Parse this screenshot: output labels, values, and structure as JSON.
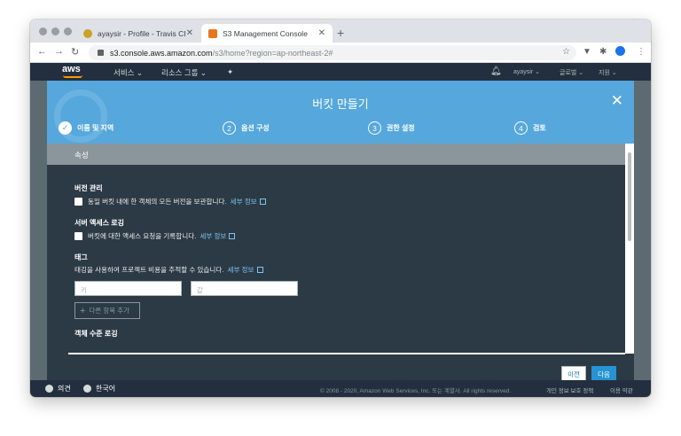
{
  "browser": {
    "tabs": [
      {
        "title": "ayaysir - Profile - Travis CI",
        "favicon_color": "#c9a227"
      },
      {
        "title": "S3 Management Console",
        "favicon_color": "#e8741c"
      }
    ],
    "new_tab": "+",
    "url_host": "s3.console.aws.amazon.com",
    "url_path": "/s3/home?region=ap-northeast-2#"
  },
  "aws_nav": {
    "logo": "aws",
    "services": "서비스 ⌄",
    "resource_groups": "리소스 그룹 ⌄",
    "user": "ayaysir ⌄",
    "region": "글로벌 ⌄",
    "support": "지원 ⌄"
  },
  "modal": {
    "title": "버킷 만들기",
    "close": "✕",
    "steps": [
      {
        "num": "✓",
        "label": "이름 및 지역",
        "done": true
      },
      {
        "num": "2",
        "label": "옵션 구성"
      },
      {
        "num": "3",
        "label": "권한 설정"
      },
      {
        "num": "4",
        "label": "검토"
      }
    ],
    "section_title": "속성",
    "versioning": {
      "label": "버전 관리",
      "checkbox_text": "동일 버킷 내에 한 객체의 모든 버전을 보관합니다.",
      "link": "세부 정보"
    },
    "access_logging": {
      "label": "서버 액세스 로깅",
      "checkbox_text": "버킷에 대한 액세스 요청을 기록합니다.",
      "link": "세부 정보"
    },
    "tags": {
      "label": "태그",
      "description": "태깅을 사용하여 프로젝트 비용을 추적할 수 있습니다.",
      "link": "세부 정보",
      "key_placeholder": "키",
      "value_placeholder": "값",
      "add_button": "다른 항목 추가"
    },
    "object_logging_label": "객체 수준 로깅",
    "prev_button": "이전",
    "next_button": "다음"
  },
  "footer": {
    "feedback": "의견",
    "language": "한국어",
    "copyright": "© 2008 - 2020, Amazon Web Services, Inc. 또는 계열사. All rights reserved.",
    "privacy": "개인 정보 보호 정책",
    "terms": "이용 약관"
  },
  "colors": {
    "modal_header": "#56a8dc",
    "modal_body": "#2b3a44",
    "aws_nav": "#232f3e",
    "primary_button": "#2693d4",
    "link": "#7cc3ee"
  }
}
